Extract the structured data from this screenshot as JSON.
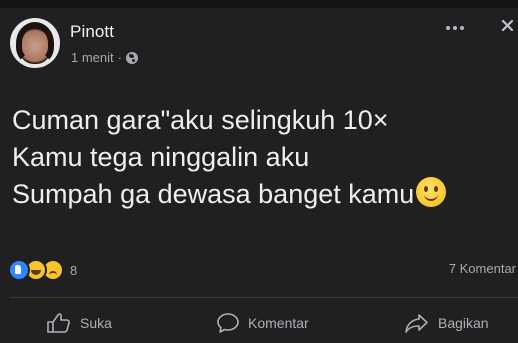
{
  "post": {
    "author": "Pinott",
    "time": "1 menit",
    "separator": "·",
    "text_lines": [
      "Cuman gara\"aku selingkuh 10×",
      "Kamu tega ninggalin aku",
      "Sumpah ga dewasa banget kamu"
    ],
    "end_emoji": "slightly-smiling-face-emoji"
  },
  "stats": {
    "reaction_types": [
      "like",
      "haha",
      "sad"
    ],
    "reaction_count": "8",
    "comment_count": "7 Komentar"
  },
  "actions": {
    "like_label": "Suka",
    "comment_label": "Komentar",
    "share_label": "Bagikan"
  },
  "colors": {
    "background": "#202022",
    "text": "#eeeeef",
    "secondary_text": "#a9a9ad",
    "like_blue": "#2d88ff",
    "emoji_yellow": "#f7c52b"
  }
}
